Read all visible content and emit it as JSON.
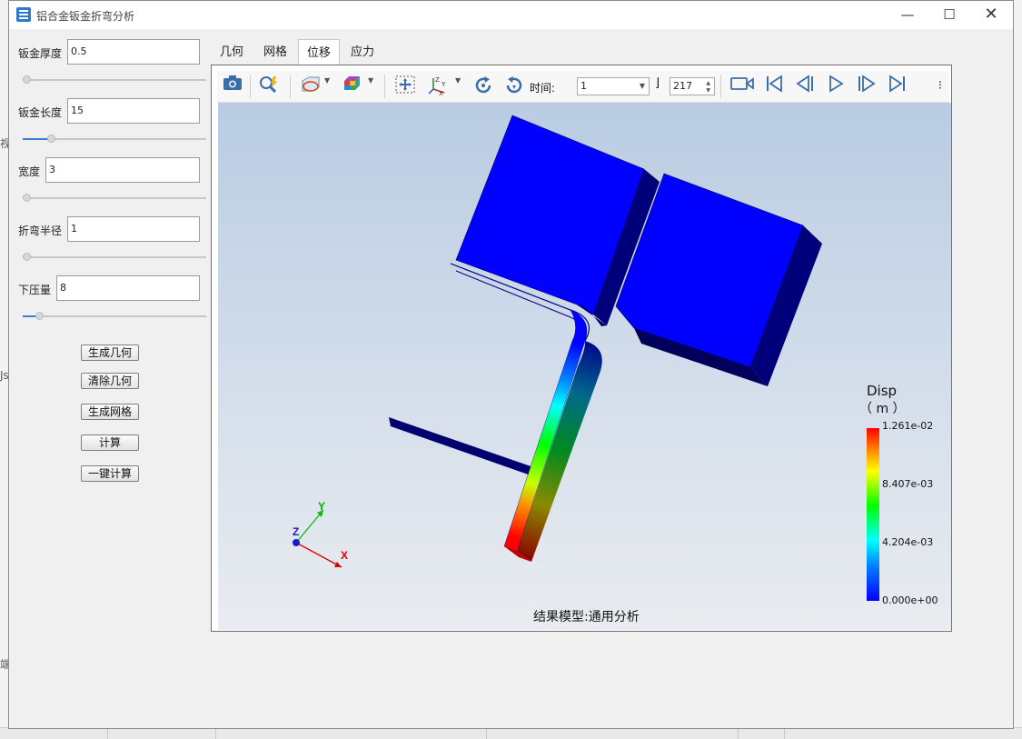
{
  "window": {
    "title": "铝合金钣金折弯分析",
    "minimize_glyph": "—",
    "maximize_glyph": "☐",
    "close_glyph": "✕"
  },
  "backdrop": {
    "fragments": [
      "视",
      "Js",
      "端"
    ]
  },
  "params": [
    {
      "label": "钣金厚度",
      "value": "0.5",
      "slider_fraction": 0.0
    },
    {
      "label": "钣金长度",
      "value": "15",
      "slider_fraction": 0.14
    },
    {
      "label": "宽度",
      "value": "3",
      "slider_fraction": 0.0
    },
    {
      "label": "折弯半径",
      "value": "1",
      "slider_fraction": 0.0
    },
    {
      "label": "下压量",
      "value": "8",
      "slider_fraction": 0.07
    }
  ],
  "buttons": {
    "gen_geometry": "生成几何",
    "clear_geometry": "清除几何",
    "gen_mesh": "生成网格",
    "compute": "计算",
    "one_click": "一键计算"
  },
  "tabs": [
    {
      "label": "几何",
      "active": false
    },
    {
      "label": "网格",
      "active": false
    },
    {
      "label": "位移",
      "active": true
    },
    {
      "label": "应力",
      "active": false
    }
  ],
  "toolbar": {
    "time_label": "时间:",
    "time_value": "1",
    "frame_value": "217",
    "icons": [
      "camera-icon",
      "query-icon",
      "display-mode-icon",
      "color-cube-icon",
      "fit-view-icon",
      "axis-icon",
      "rotate-cw-icon",
      "rotate-ccw-icon",
      "record-icon",
      "first-frame-icon",
      "prev-frame-icon",
      "play-icon",
      "next-frame-icon",
      "last-frame-icon"
    ]
  },
  "legend": {
    "title": "Disp",
    "unit": "（ m ）",
    "colors": [
      "#f00000",
      "#ffff00",
      "#00ff00",
      "#00ffff",
      "#0000ff"
    ],
    "ticks": [
      "1.261e-02",
      "8.407e-03",
      "4.204e-03",
      "0.000e+00"
    ]
  },
  "axes": {
    "x": "X",
    "y": "Y",
    "z": "Z"
  },
  "caption": "结果模型:通用分析"
}
